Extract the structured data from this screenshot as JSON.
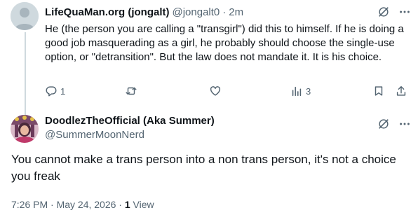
{
  "parent_tweet": {
    "display_name": "LifeQuaMan.org (jongalt)",
    "handle": "@jongalt0",
    "separator": "·",
    "time": "2m",
    "text": "He (the person you are calling a \"transgirl\") did this to himself.  If he is doing a good job masquerading as a girl, he probably should choose the single-use option, or \"detransition\".  But the law does not mandate it.  It is his choice.",
    "actions": {
      "replies": "1",
      "retweets": "",
      "likes": "",
      "views": "3"
    },
    "icons": [
      "grok-icon",
      "more-icon",
      "reply-icon",
      "retweet-icon",
      "like-icon",
      "views-icon",
      "bookmark-icon",
      "share-icon"
    ]
  },
  "main_tweet": {
    "display_name": "DoodlezTheOfficial (Aka Summer)",
    "handle": "@SummerMoonNerd",
    "text": "You cannot make a trans person into a non trans person, it's not a choice you freak",
    "timestamp": "7:26 PM · May 24, 2026 · ",
    "views_count": "1",
    "views_label": " View",
    "icons": [
      "grok-icon",
      "more-icon"
    ]
  },
  "colors": {
    "text_primary": "#0f1419",
    "text_secondary": "#536471",
    "thread_line": "#cfd9de",
    "background": "#ffffff"
  }
}
